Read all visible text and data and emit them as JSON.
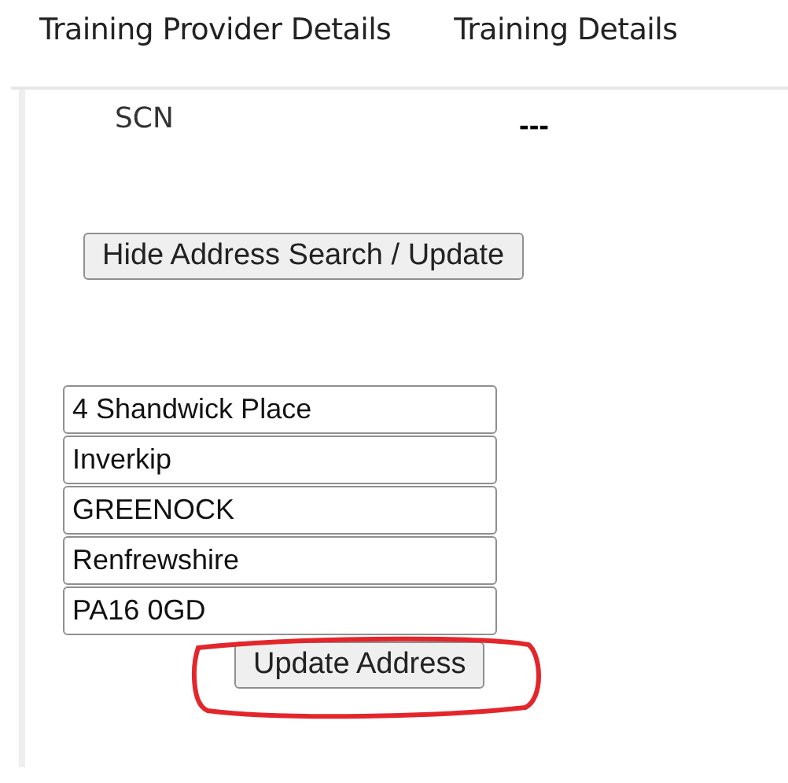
{
  "tabs": [
    {
      "label": "Training Provider Details"
    },
    {
      "label": "Training Details"
    }
  ],
  "field": {
    "label": "SCN",
    "value": "---"
  },
  "toggle_button": "Hide Address Search / Update",
  "address_lines": [
    {
      "value": "4 Shandwick Place"
    },
    {
      "value": "Inverkip"
    },
    {
      "value": "GREENOCK"
    },
    {
      "value": "Renfrewshire"
    },
    {
      "value": "PA16 0GD"
    }
  ],
  "update_button": "Update Address"
}
